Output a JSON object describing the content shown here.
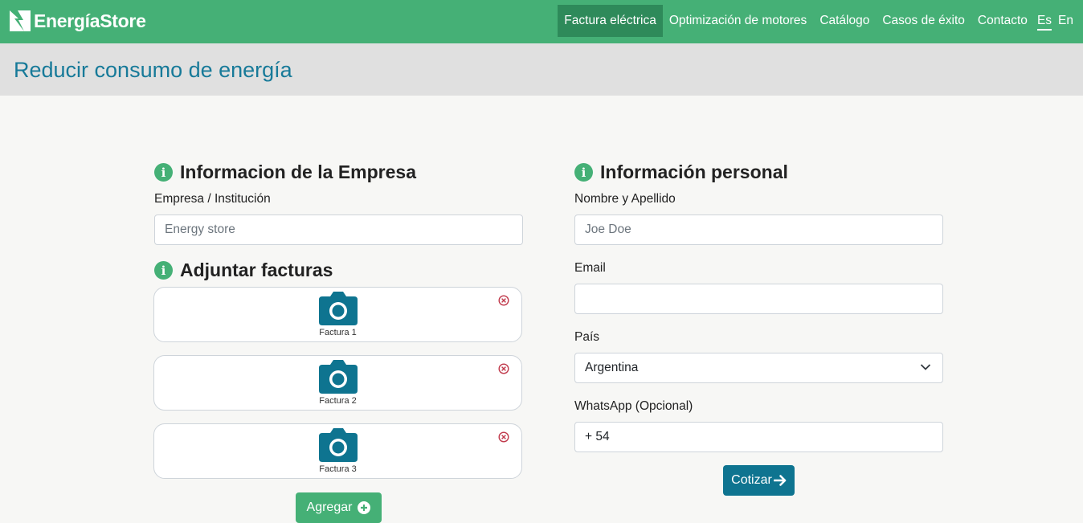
{
  "brand": {
    "name": "EnergíaStore"
  },
  "nav": {
    "items": [
      "Factura eléctrica",
      "Optimización de motores",
      "Catálogo",
      "Casos de éxito",
      "Contacto"
    ],
    "active": "Factura eléctrica",
    "langs": [
      "Es",
      "En"
    ],
    "active_lang": "Es"
  },
  "page": {
    "title": "Reducir consumo de energía"
  },
  "company": {
    "heading": "Informacion de la Empresa",
    "field_label": "Empresa / Institución",
    "field_placeholder": "Energy store",
    "field_value": ""
  },
  "invoices": {
    "heading": "Adjuntar facturas",
    "items": [
      "Factura 1",
      "Factura 2",
      "Factura 3"
    ],
    "add_label": "Agregar"
  },
  "personal": {
    "heading": "Información personal",
    "name_label": "Nombre y Apellido",
    "name_placeholder": "Joe Doe",
    "email_label": "Email",
    "email_value": "",
    "country_label": "País",
    "country_value": "Argentina",
    "whatsapp_label": "WhatsApp (Opcional)",
    "whatsapp_value": "+ 54",
    "submit_label": "Cotizar"
  },
  "colors": {
    "accent_green": "#45b076",
    "title_blue": "#177a99",
    "button_blue": "#0e7490",
    "remove_red": "#c0394b"
  }
}
